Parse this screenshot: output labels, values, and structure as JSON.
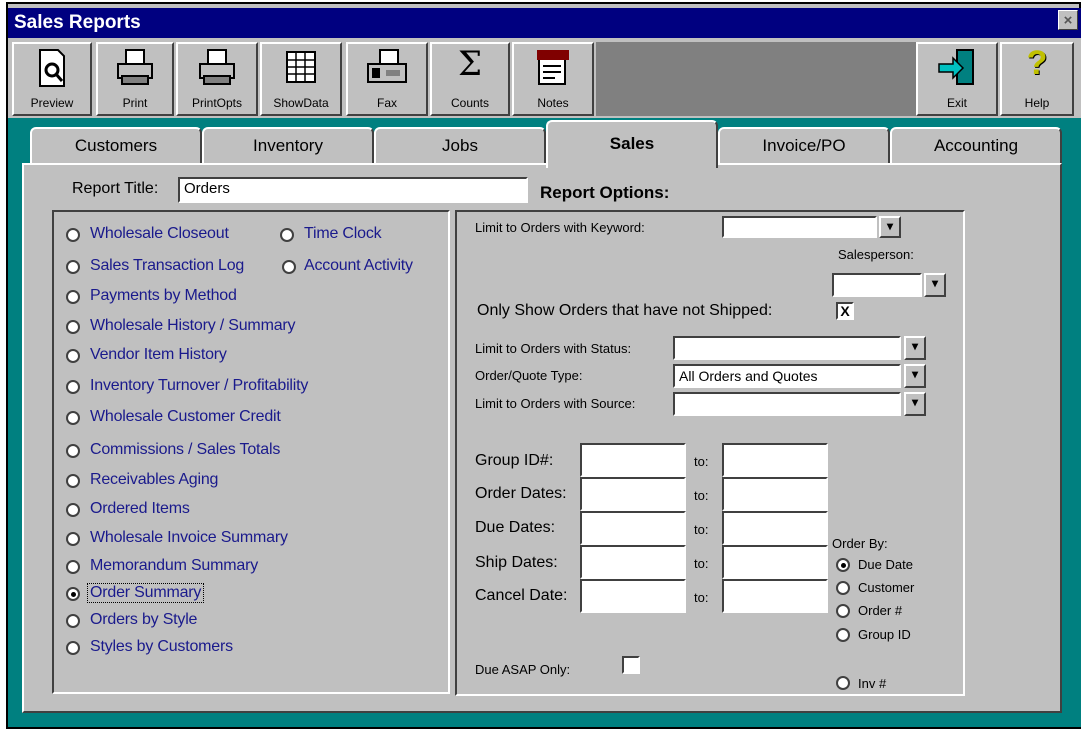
{
  "window": {
    "title": "Sales Reports",
    "close_glyph": "×"
  },
  "toolbar": {
    "buttons": [
      {
        "label": "Preview",
        "icon": "preview-icon"
      },
      {
        "label": "Print",
        "icon": "printer-icon"
      },
      {
        "label": "PrintOpts",
        "icon": "print-options-icon"
      },
      {
        "label": "ShowData",
        "icon": "grid-icon"
      },
      {
        "label": "Fax",
        "icon": "fax-icon"
      },
      {
        "label": "Counts",
        "icon": "sigma-icon",
        "glyph": "Σ"
      },
      {
        "label": "Notes",
        "icon": "notes-icon"
      },
      {
        "label": "Exit",
        "icon": "exit-icon"
      },
      {
        "label": "Help",
        "icon": "help-icon",
        "glyph": "?"
      }
    ]
  },
  "tabs": [
    "Customers",
    "Inventory",
    "Jobs",
    "Sales",
    "Invoice/PO",
    "Accounting"
  ],
  "active_tab": "Sales",
  "report_title": {
    "label": "Report Title:",
    "value": "Orders"
  },
  "report_options_label": "Report Options:",
  "reports": {
    "selected": "Order Summary",
    "items": [
      "Wholesale Closeout",
      "Time Clock",
      "Sales Transaction Log",
      "Account Activity",
      "Payments by Method",
      "Wholesale History / Summary",
      "Vendor Item History",
      "Inventory Turnover / Profitability",
      "Wholesale Customer Credit",
      "Commissions / Sales Totals",
      "Receivables Aging",
      "Ordered Items",
      "Wholesale Invoice Summary",
      "Memorandum Summary",
      "Order Summary",
      "Orders by Style",
      "Styles by Customers"
    ]
  },
  "options": {
    "keyword_label": "Limit to Orders with Keyword:",
    "keyword_value": "",
    "salesperson_label": "Salesperson:",
    "salesperson_value": "",
    "not_shipped_label": "Only Show Orders that have not Shipped:",
    "not_shipped_checked": true,
    "check_glyph": "X",
    "dropdown_glyph": "▾",
    "status_label": "Limit to Orders with Status:",
    "status_value": "",
    "type_label": "Order/Quote Type:",
    "type_value": "All Orders and Quotes",
    "source_label": "Limit to Orders with Source:",
    "source_value": "",
    "ranges": [
      {
        "label": "Group ID#:",
        "to": "to:"
      },
      {
        "label": "Order Dates:",
        "to": "to:"
      },
      {
        "label": "Due Dates:",
        "to": "to:"
      },
      {
        "label": "Ship Dates:",
        "to": "to:"
      },
      {
        "label": "Cancel Date:",
        "to": "to:"
      }
    ],
    "order_by_label": "Order By:",
    "order_by": [
      "Due Date",
      "Customer",
      "Order #",
      "Group ID",
      "Inv #"
    ],
    "order_by_selected": "Due Date",
    "due_asap_label": "Due ASAP Only:",
    "due_asap_checked": false
  },
  "colors": {
    "title_bar": "#000080",
    "teal": "#008080",
    "face": "#c0c0c0",
    "radio_text": "#1a1a8c"
  }
}
